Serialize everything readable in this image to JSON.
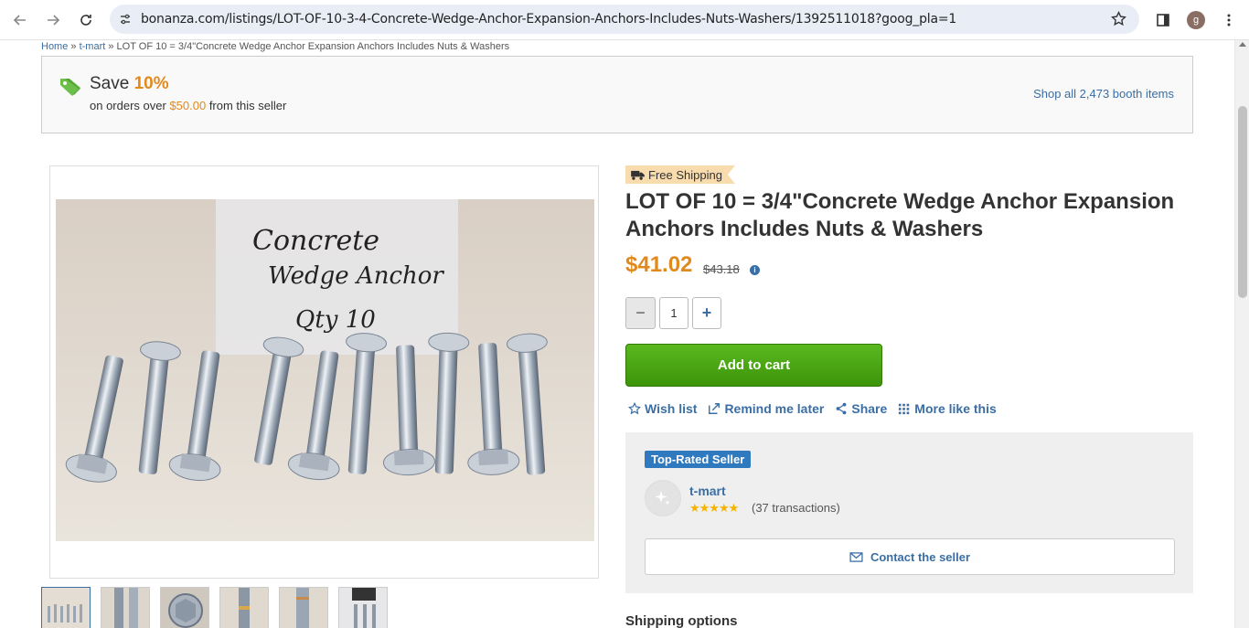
{
  "browser": {
    "url": "bonanza.com/listings/LOT-OF-10-3-4-Concrete-Wedge-Anchor-Expansion-Anchors-Includes-Nuts-Washers/1392511018?goog_pla=1",
    "profile_initial": "g"
  },
  "breadcrumb": {
    "home": "Home",
    "sep1": " » ",
    "shop": "t-mart",
    "sep2": " » ",
    "current": "LOT OF 10 = 3/4\"Concrete Wedge Anchor Expansion Anchors Includes Nuts & Washers"
  },
  "promo": {
    "save_label": "Save ",
    "save_percent": "10%",
    "sub_prefix": "on orders over ",
    "sub_amount": "$50.00",
    "sub_suffix": " from this seller",
    "shop_all": "Shop all 2,473 booth items"
  },
  "product": {
    "free_shipping": "Free Shipping",
    "title": "LOT OF 10 = 3/4\"Concrete Wedge Anchor Expansion Anchors Includes Nuts & Washers",
    "price": "$41.02",
    "original_price": "$43.18",
    "info_icon": "i",
    "quantity": "1",
    "minus": "−",
    "plus": "+",
    "add_to_cart": "Add to cart",
    "image_text": [
      "Concrete",
      "Wedge Anchor",
      "Qty 10"
    ]
  },
  "actions": {
    "wish_list": "Wish list",
    "remind": "Remind me later",
    "share": "Share",
    "more_like": "More like this"
  },
  "seller": {
    "badge": "Top-Rated Seller",
    "name": "t-mart",
    "stars": "★★★★★",
    "transactions": "(37 transactions)",
    "contact": "Contact the seller"
  },
  "shipping": {
    "heading": "Shipping options"
  },
  "colors": {
    "accent_orange": "#e08a1e",
    "link_blue": "#3a6ea5",
    "cart_green": "#4aa614"
  }
}
